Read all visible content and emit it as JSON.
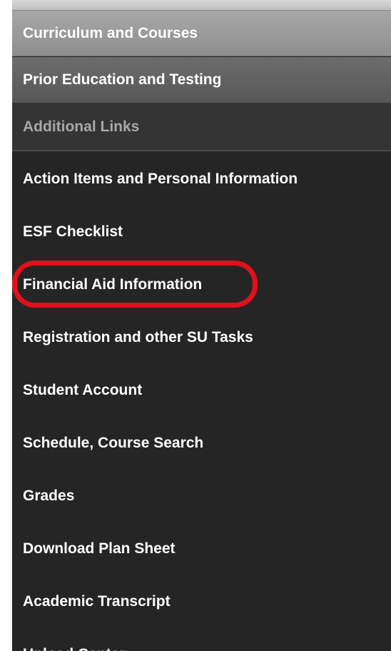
{
  "sections": {
    "curriculum": "Curriculum and Courses",
    "prior_education": "Prior Education and Testing",
    "additional_links": "Additional Links"
  },
  "links": [
    "Action Items and Personal Information",
    "ESF Checklist",
    "Financial Aid Information",
    "Registration and other SU Tasks",
    "Student Account",
    "Schedule, Course Search",
    "Grades",
    "Download Plan Sheet",
    "Academic Transcript",
    "Upload Center"
  ],
  "highlighted_link": "Financial Aid Information",
  "colors": {
    "panel_background": "#252525",
    "highlight_ring": "#e0101c",
    "link_text": "#ffffff",
    "subheader_text": "#a8a8a8"
  }
}
